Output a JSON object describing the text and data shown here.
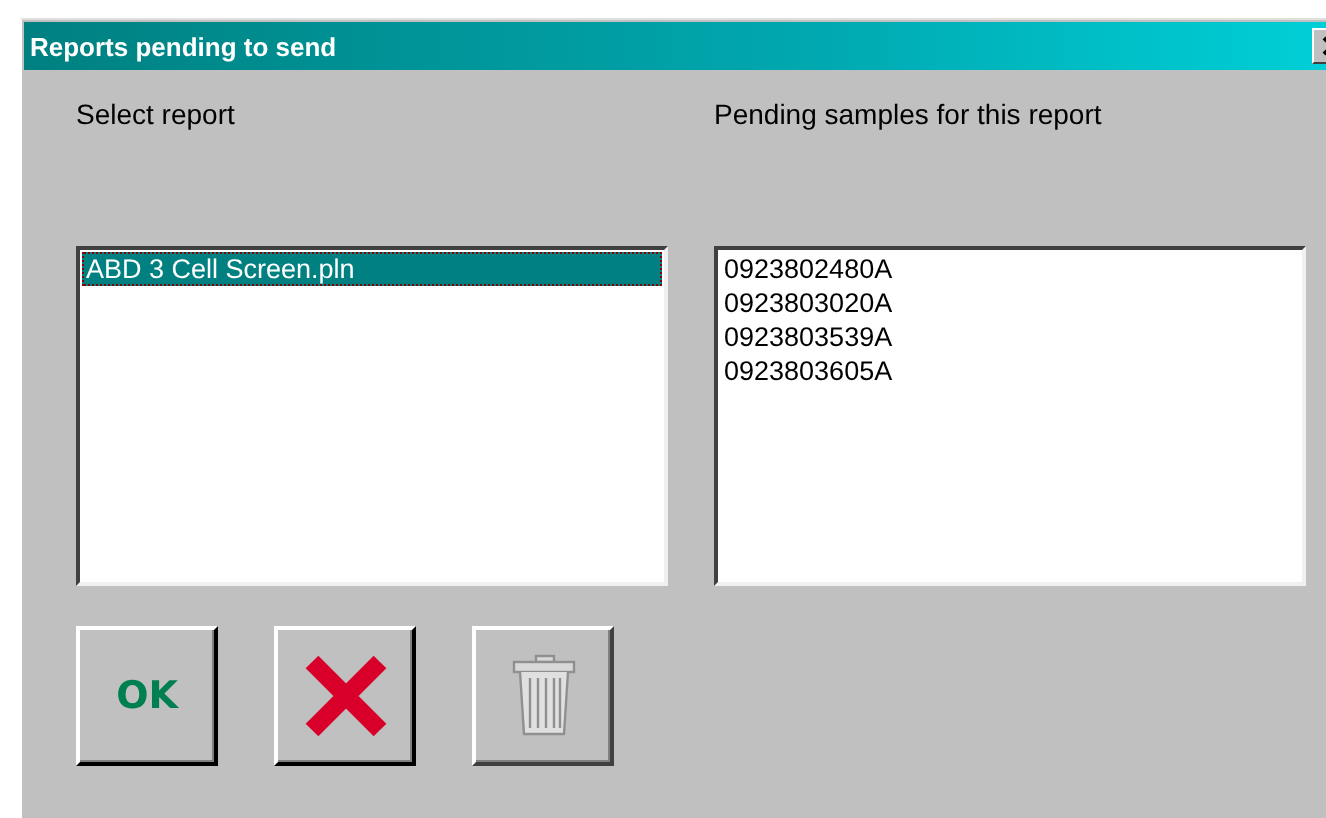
{
  "window": {
    "title": "Reports pending to send"
  },
  "reports": {
    "label": "Select report",
    "items": [
      {
        "name": "ABD 3 Cell Screen.pln",
        "selected": true
      }
    ]
  },
  "samples": {
    "label": "Pending samples for this report",
    "items": [
      "0923802480A",
      "0923803020A",
      "0923803539A",
      "0923803605A"
    ]
  },
  "buttons": [
    {
      "kind": "ok",
      "label": "OK",
      "disabled": false
    },
    {
      "kind": "cancel",
      "disabled": false
    },
    {
      "kind": "delete",
      "disabled": true
    }
  ]
}
